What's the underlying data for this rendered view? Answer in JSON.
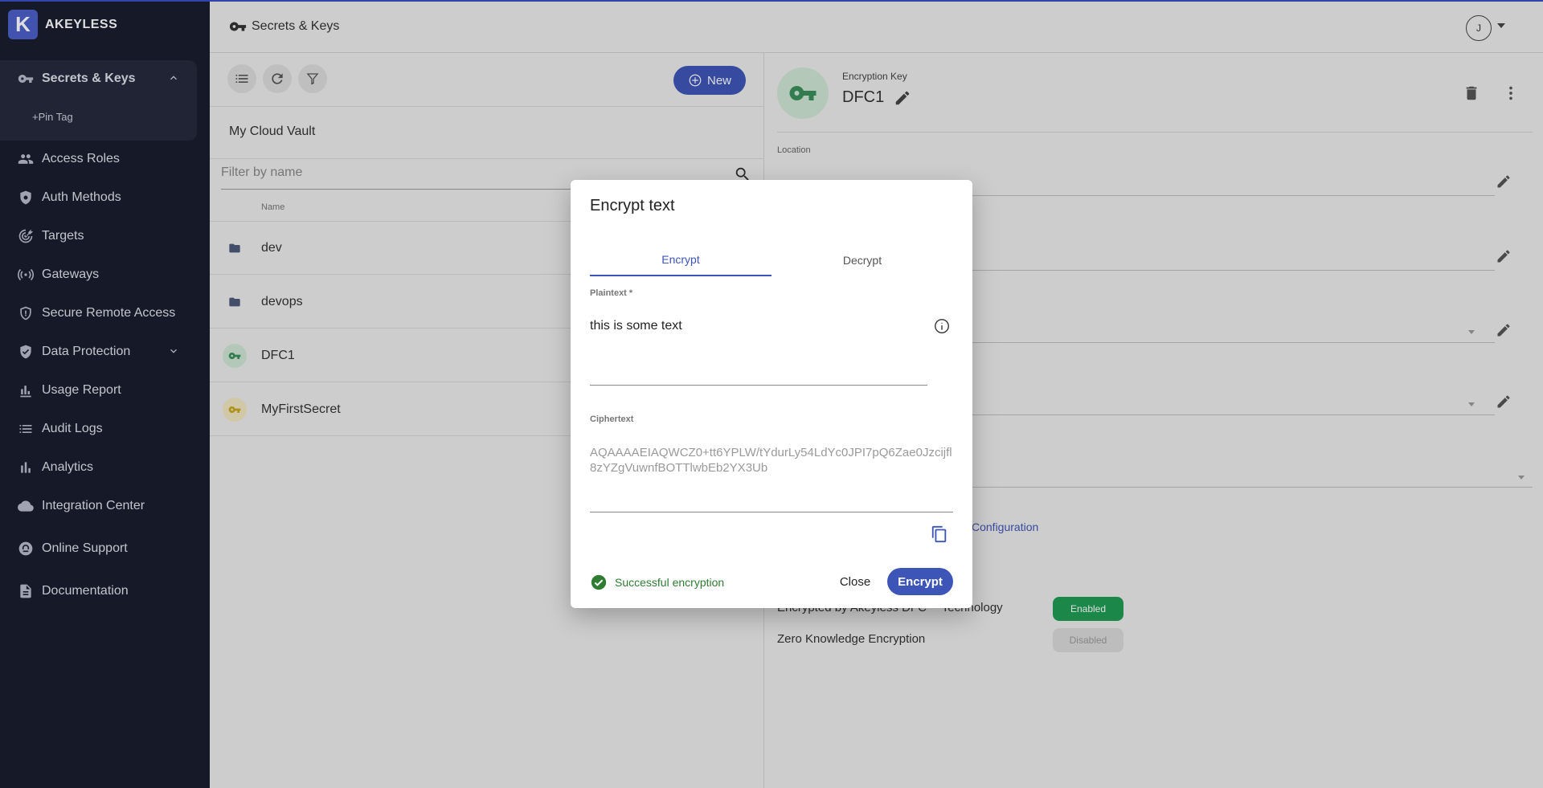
{
  "app": {
    "brand_name": "AKEYLESS",
    "brand_mark": "K"
  },
  "sidebar": {
    "items": [
      {
        "label": "Secrets & Keys",
        "icon": "key-icon"
      },
      {
        "label": "Access Roles",
        "icon": "people-icon"
      },
      {
        "label": "Auth Methods",
        "icon": "gear-shield-icon"
      },
      {
        "label": "Targets",
        "icon": "target-icon"
      },
      {
        "label": "Gateways",
        "icon": "gateway-icon"
      },
      {
        "label": "Secure Remote Access",
        "icon": "shield-icon"
      },
      {
        "label": "Data Protection",
        "icon": "shield-check-icon"
      },
      {
        "label": "Usage Report",
        "icon": "usage-icon"
      },
      {
        "label": "Audit Logs",
        "icon": "list-icon"
      },
      {
        "label": "Analytics",
        "icon": "bar-chart-icon"
      },
      {
        "label": "Integration Center",
        "icon": "cloud-icon"
      },
      {
        "label": "Online Support",
        "icon": "support-icon"
      },
      {
        "label": "Documentation",
        "icon": "document-icon"
      }
    ],
    "pin_tag": "+Pin Tag"
  },
  "topbar": {
    "title": "Secrets & Keys",
    "avatar_initial": "J"
  },
  "list_panel": {
    "new_button": "New",
    "vault_name": "My Cloud Vault",
    "filter_placeholder": "Filter by name",
    "column_name": "Name",
    "rows": [
      {
        "label": "dev",
        "type": "folder"
      },
      {
        "label": "devops",
        "type": "folder"
      },
      {
        "label": "DFC1",
        "type": "encryption-key"
      },
      {
        "label": "MyFirstSecret",
        "type": "secret"
      }
    ]
  },
  "detail": {
    "item_type": "Encryption Key",
    "item_name": "DFC1",
    "location_label": "Location",
    "config_link": "Configuration",
    "props": [
      {
        "label": "Encrypted by Akeyless DFC™ Technology",
        "status": "Enabled"
      },
      {
        "label": "Zero Knowledge Encryption",
        "status": "Disabled"
      }
    ]
  },
  "dialog": {
    "title": "Encrypt text",
    "tabs": [
      "Encrypt",
      "Decrypt"
    ],
    "plaintext_label": "Plaintext *",
    "plaintext_value": "this is some text",
    "ciphertext_label": "Ciphertext",
    "ciphertext_value": "AQAAAAEIAQWCZ0+tt6YPLW/tYdurLy54LdYc0JPI7pQ6Zae0Jzcijfl8zYZgVuwnfBOTTlwbEb2YX3Ub",
    "status_text": "Successful encryption",
    "close_button": "Close",
    "encrypt_button": "Encrypt"
  },
  "colors": {
    "accent": "#3e55b8",
    "sidebar_bg": "#1a1d2e",
    "success": "#2e7d32",
    "enabled_pill": "#1f9d55",
    "disabled_pill": "#d9d9d9"
  }
}
